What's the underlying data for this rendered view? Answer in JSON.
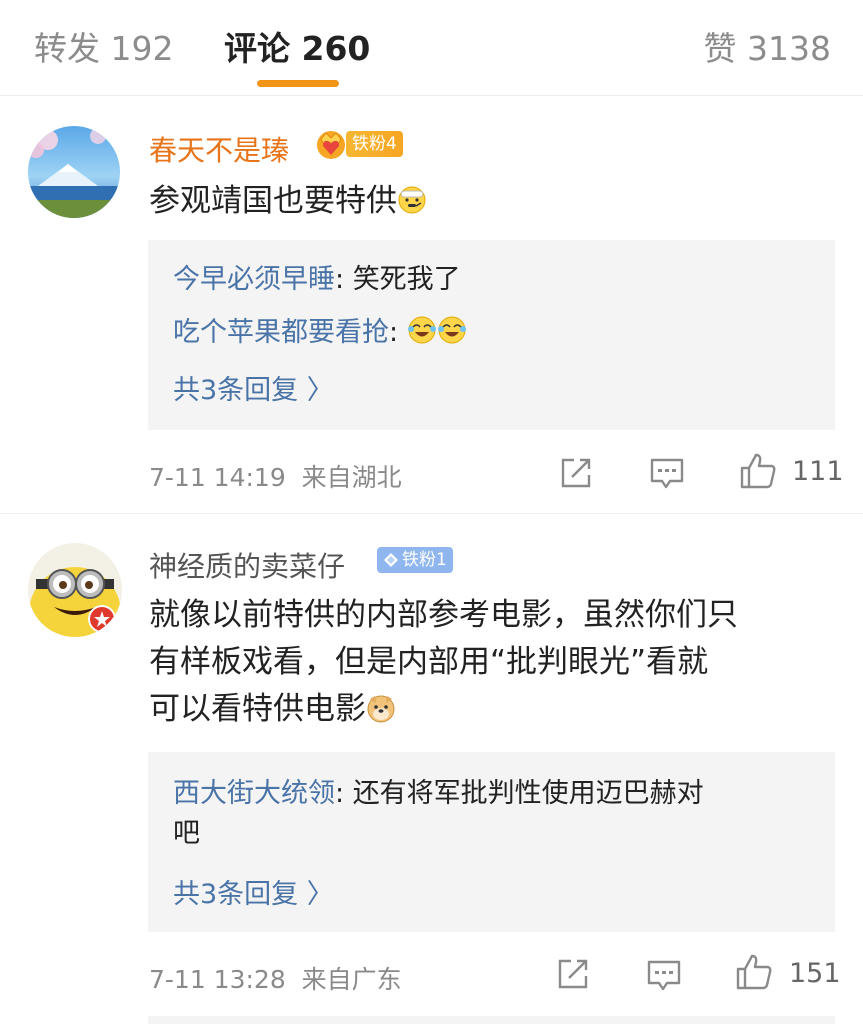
{
  "tabs": {
    "repost": "转发 192",
    "comment": "评论 260",
    "like": "赞 3138"
  },
  "comments": [
    {
      "username": "春天不是瑧",
      "badge": "铁粉4",
      "text": "参观靖国也要特供",
      "replies": [
        {
          "user": "今早必须早睡",
          "text": "笑死我了"
        },
        {
          "user": "吃个苹果都要看抢",
          "text": ""
        }
      ],
      "more_replies": "共3条回复 〉",
      "time": "7-11 14:19",
      "location": "来自湖北",
      "likes": "111"
    },
    {
      "username": "神经质的卖菜仔",
      "badge": "铁粉1",
      "text_lines": [
        "就像以前特供的内部参考电影，虽然你们只",
        "有样板戏看，但是内部用“批判眼光”看就",
        "可以看特供电影"
      ],
      "replies": [
        {
          "user": "西大街大统领",
          "text": "还有将军批判性使用迈巴赫对",
          "text2": "吧"
        }
      ],
      "more_replies": "共3条回复 〉",
      "time": "7-11 13:28",
      "location": "来自广东",
      "likes": "151"
    }
  ],
  "colors": {
    "accent": "#f29418",
    "link": "#4a74a8",
    "vip_name": "#e8741a"
  }
}
